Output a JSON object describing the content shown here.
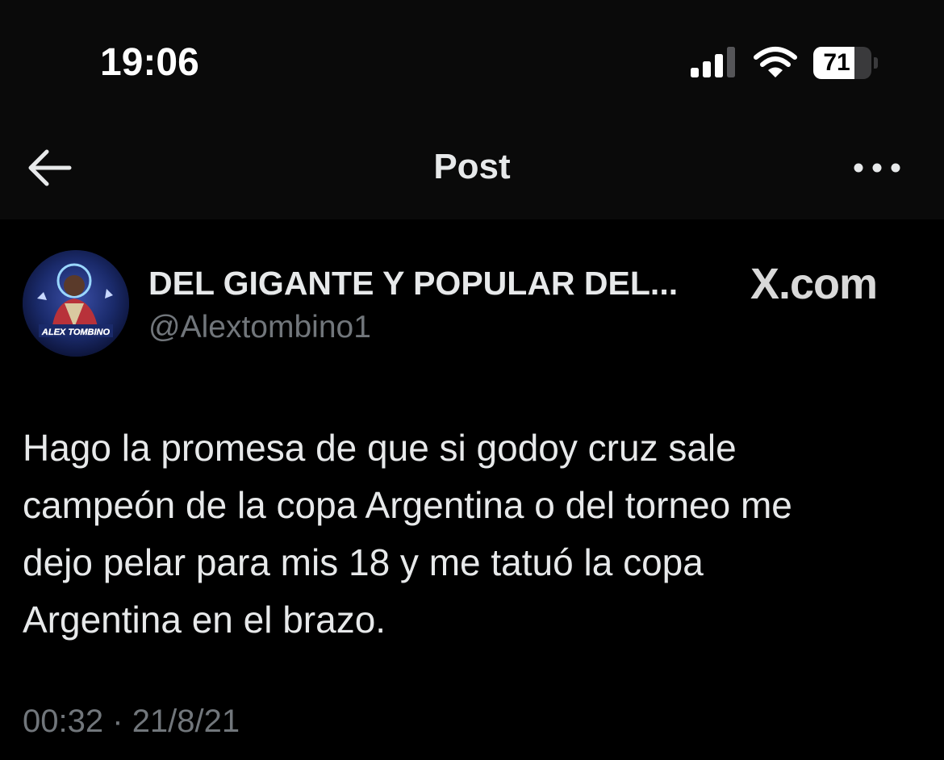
{
  "status_bar": {
    "time": "19:06",
    "battery_level": "71",
    "battery_fraction": 0.71
  },
  "header": {
    "title": "Post",
    "back_icon": "arrow-left-icon",
    "more_icon": "more-horizontal-icon"
  },
  "post": {
    "author": {
      "display_name": "DEL GIGANTE Y POPULAR DEL...",
      "handle": "@Alextombino1",
      "avatar_text": "ALEX TOMBINO"
    },
    "watermark": "X.com",
    "text": "Hago la promesa de que si godoy cruz sale\ncampeón de la copa Argentina o del torneo me\ndejo pelar para mis 18 y me tatuó la copa\nArgentina en el brazo.",
    "time": "00:32",
    "separator": "·",
    "date": "21/8/21"
  },
  "colors": {
    "background": "#000000",
    "header_background": "#0a0a0a",
    "text_primary": "#e7e9ea",
    "text_secondary": "#71767b"
  }
}
